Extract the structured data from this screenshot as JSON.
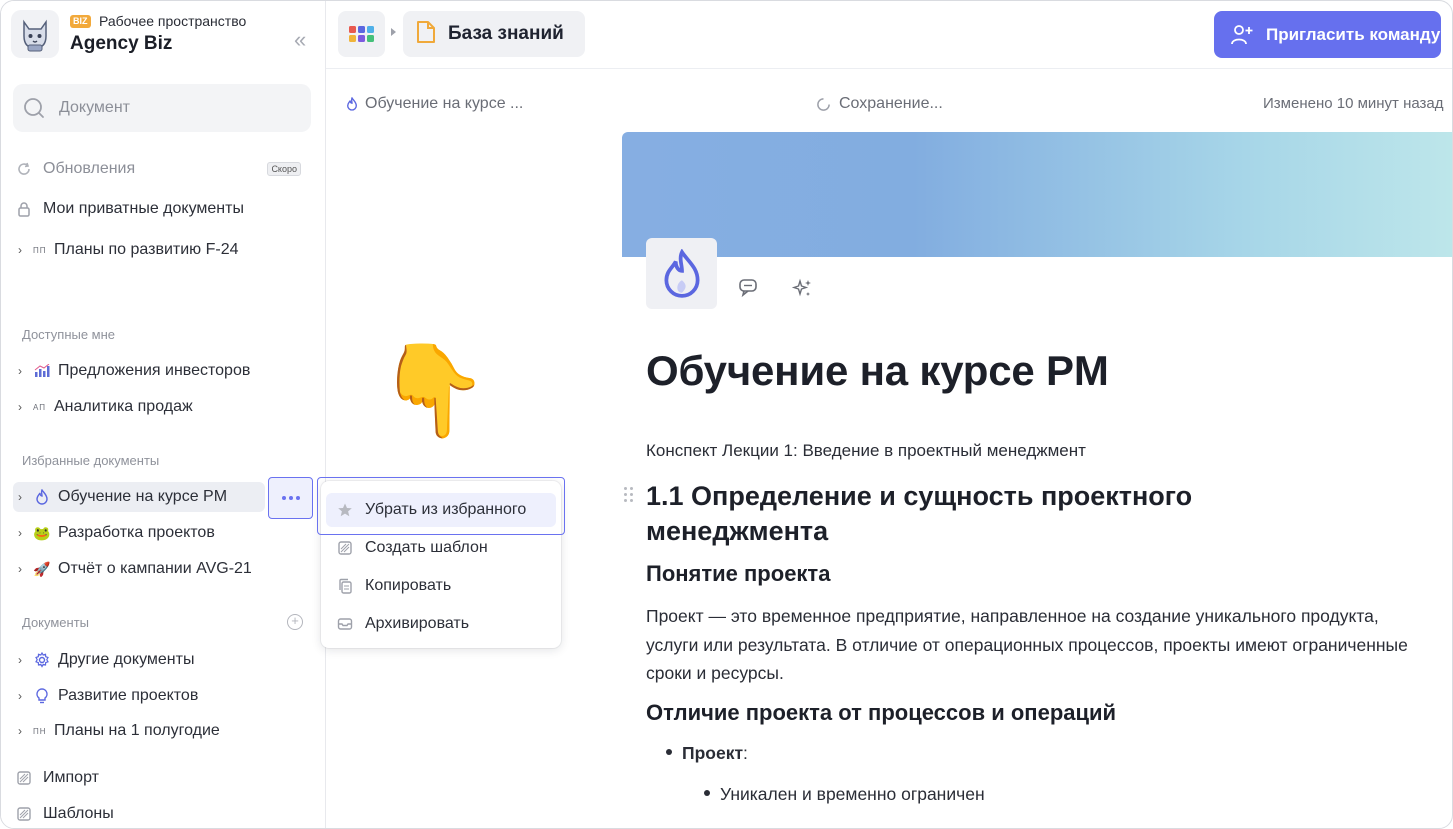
{
  "workspace": {
    "badge": "BIZ",
    "subtitle": "Рабочее пространство",
    "name": "Agency Biz"
  },
  "search": {
    "placeholder": "Документ"
  },
  "sidebar": {
    "top_items": [
      {
        "label": "Обновления",
        "badge": "Скоро",
        "icon": "refresh-icon"
      },
      {
        "label": "Мои приватные документы",
        "icon": "lock-icon"
      },
      {
        "label": "Планы по развитию F-24",
        "abbr": "ПП"
      }
    ],
    "shared_title": "Доступные мне",
    "shared_items": [
      {
        "label": "Предложения инвесторов",
        "icon": "chart-icon"
      },
      {
        "label": "Аналитика продаж",
        "abbr": "АП"
      }
    ],
    "favorites_title": "Избранные документы",
    "favorite_items": [
      {
        "label": "Обучение на курсе PM",
        "icon": "flame-icon"
      },
      {
        "label": "Разработка проектов",
        "icon": "frog-emoji"
      },
      {
        "label": "Отчёт о кампании AVG-21",
        "icon": "rocket-emoji"
      }
    ],
    "docs_title": "Документы",
    "doc_items": [
      {
        "label": "Другие документы",
        "icon": "gear-icon"
      },
      {
        "label": "Развитие проектов",
        "icon": "lightbulb-icon"
      },
      {
        "label": "Планы на 1 полугодие",
        "abbr": "ПН"
      }
    ],
    "bottom_items": [
      {
        "label": "Импорт",
        "icon": "import-icon"
      },
      {
        "label": "Шаблоны",
        "icon": "templates-icon"
      }
    ]
  },
  "topbar": {
    "breadcrumb": "База знаний",
    "invite_label": "Пригласить команду",
    "colors": {
      "accent": "#6670ee"
    }
  },
  "docbar": {
    "title": "Обучение на курсе ...",
    "status": "Сохранение...",
    "changed": "Изменено 10 минут назад"
  },
  "context_menu": {
    "items": [
      {
        "label": "Убрать из избранного",
        "icon": "star-icon"
      },
      {
        "label": "Создать шаблон",
        "icon": "template-icon"
      },
      {
        "label": "Копировать",
        "icon": "copy-icon"
      },
      {
        "label": "Архивировать",
        "icon": "archive-icon"
      }
    ]
  },
  "pointer_emoji": "👇",
  "document": {
    "title": "Обучение на курсе PM",
    "intro": "Конспект Лекции 1: Введение в проектный менеджмент",
    "h2": "1.1 Определение и сущность проектного менеджмента",
    "h3_1": "Понятие проекта",
    "para": "Проект — это временное предприятие, направленное на создание уникального продукта, услуги или результата. В отличие от операционных процессов, проекты имеют ограниченные сроки и ресурсы.",
    "h3_2": "Отличие проекта от процессов и операций",
    "bullet_label": "Проект",
    "bullet_colon": ":",
    "sub_bullet": "Уникален и временно ограничен"
  }
}
